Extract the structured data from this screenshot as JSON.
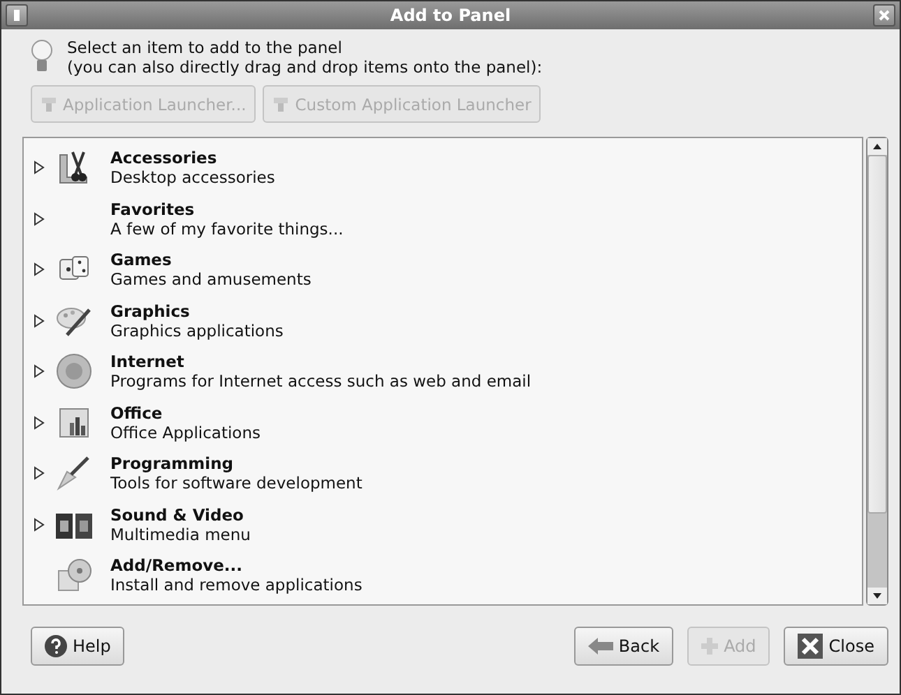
{
  "window": {
    "title": "Add to Panel"
  },
  "intro": {
    "line_1": "Select an item to add to the panel",
    "line_2": "(you can also directly drag and drop items onto the panel):"
  },
  "launcher_buttons": [
    {
      "label": "Application Launcher...",
      "disabled": true
    },
    {
      "label": "Custom Application Launcher",
      "disabled": true
    }
  ],
  "items": [
    {
      "kind": "category",
      "expanded": false,
      "title": "Accessories",
      "description": "Desktop accessories"
    },
    {
      "kind": "category",
      "expanded": false,
      "title": "Favorites",
      "description": "A few of my favorite things..."
    },
    {
      "kind": "category",
      "expanded": false,
      "title": "Games",
      "description": "Games and amusements"
    },
    {
      "kind": "category",
      "expanded": false,
      "title": "Graphics",
      "description": "Graphics applications"
    },
    {
      "kind": "category",
      "expanded": false,
      "title": "Internet",
      "description": "Programs for Internet access such as web and email"
    },
    {
      "kind": "category",
      "expanded": false,
      "title": "Office",
      "description": "Office Applications"
    },
    {
      "kind": "category",
      "expanded": false,
      "title": "Programming",
      "description": "Tools for software development"
    },
    {
      "kind": "category",
      "expanded": false,
      "title": "Sound & Video",
      "description": "Multimedia menu"
    },
    {
      "kind": "item",
      "title": "Add/Remove...",
      "description": "Install and remove applications"
    }
  ],
  "buttons": {
    "help": {
      "label": "Help",
      "disabled": false
    },
    "back": {
      "label": "Back",
      "disabled": false
    },
    "add": {
      "label": "Add",
      "disabled": true
    },
    "close": {
      "label": "Close",
      "disabled": false
    }
  }
}
